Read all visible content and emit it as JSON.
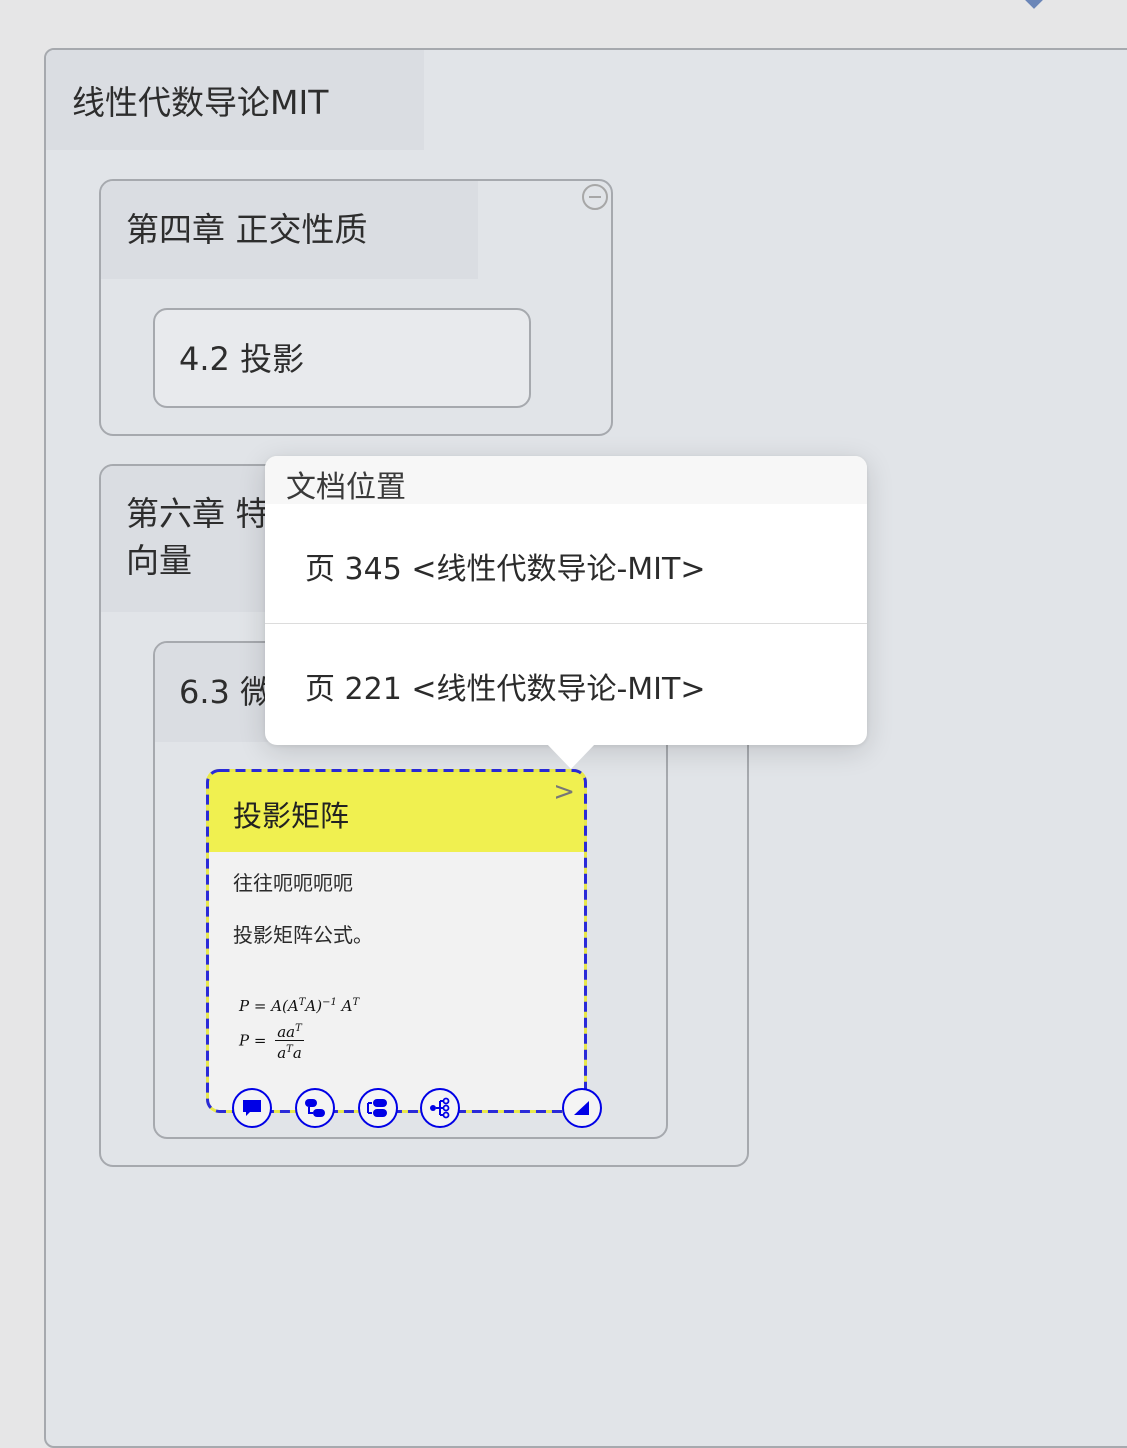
{
  "mindmap": {
    "root_title": "线性代数导论MIT",
    "chapter4": {
      "title": "第四章 正交性质",
      "section_title": "4.2 投影"
    },
    "chapter6": {
      "title_line1": "第六章 特",
      "title_line2": "向量",
      "section_title": "6.3 微"
    }
  },
  "card": {
    "title": "投影矩阵",
    "line1": "往往呃呃呃呃",
    "line2": "投影矩阵公式。",
    "formula1": {
      "lhs": "P = A",
      "t1": "T",
      "mid": "A)",
      "inv": "−1",
      "a": "A",
      "t2": "T"
    },
    "formula2": {
      "lhs": "P =",
      "num": "aa",
      "num_sup": "T",
      "den": "a",
      "den_sup": "T",
      "den_tail": "a"
    },
    "colors": {
      "header": "#f0f050",
      "border_blue": "#2a2ad8",
      "border_yellow": "#e8e84a",
      "icon_blue": "#0000e6"
    },
    "actions": [
      "comment-icon",
      "link-nodes-icon",
      "merge-icon",
      "mindmap-branch-icon",
      "resize-corner-icon"
    ]
  },
  "popover": {
    "title": "文档位置",
    "items": [
      {
        "label": "页 345 <线性代数导论-MIT>"
      },
      {
        "label": "页 221 <线性代数导论-MIT>"
      }
    ]
  }
}
